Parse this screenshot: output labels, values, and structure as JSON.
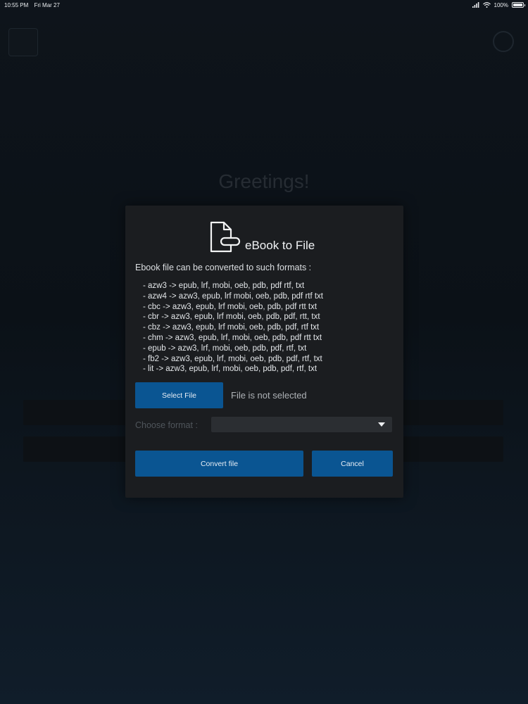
{
  "status_bar": {
    "time": "10:55 PM",
    "date": "Fri Mar 27",
    "battery": "100%"
  },
  "background": {
    "greeting": "Greetings!"
  },
  "dialog": {
    "icon": "file-export-icon",
    "title": "eBook to File",
    "intro": "Ebook file can be converted to such formats :",
    "formats": [
      "- azw3 -> epub, lrf, mobi, oeb, pdb, pdf rtf, txt",
      "- azw4 -> azw3, epub, lrf mobi, oeb, pdb, pdf rtf txt",
      "- cbc -> azw3, epub, lrf mobi, oeb, pdb, pdf rtt txt",
      "- cbr -> azw3, epub, lrf mobi, oeb, pdb, pdf, rtt, txt",
      "- cbz -> azw3, epub, lrf mobi, oeb, pdb, pdf, rtf txt",
      "- chm -> azw3, epub, lrf, mobi, oeb, pdb, pdf rtt txt",
      "- epub -> azw3, lrf, mobi, oeb, pdb, pdf, rtf, txt",
      "- fb2 -> azw3, epub, lrf, mobi, oeb, pdb, pdf, rtf, txt",
      "- lit -> azw3, epub, lrf, mobi, oeb, pdb, pdf, rtf, txt"
    ],
    "select_file_label": "Select File",
    "file_status": "File is not selected",
    "choose_format_label": "Choose format :",
    "selected_format": "",
    "convert_label": "Convert file",
    "cancel_label": "Cancel"
  }
}
